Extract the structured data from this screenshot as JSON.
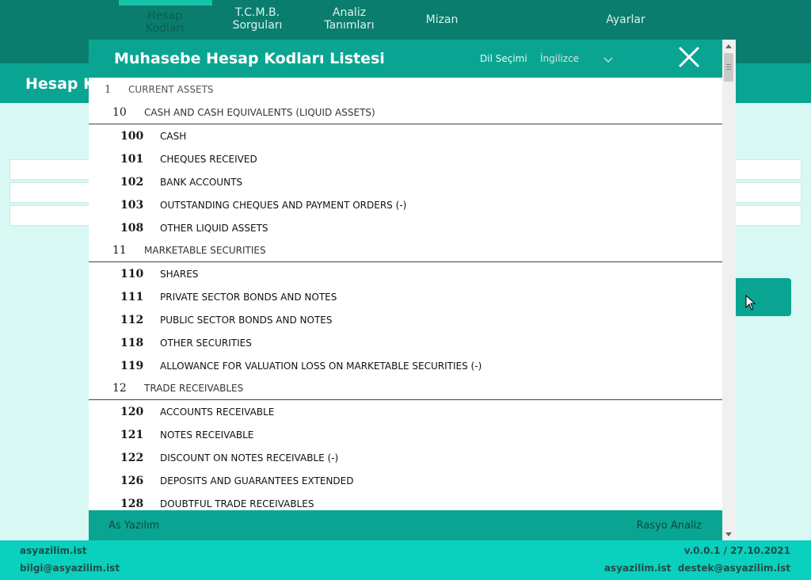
{
  "nav": {
    "items": [
      {
        "label1": "Hesap",
        "label2": "Kodları"
      },
      {
        "label1": "T.C.M.B.",
        "label2": "Sorguları"
      },
      {
        "label1": "Analiz",
        "label2": "Tanımları"
      },
      {
        "label1": "Mizan",
        "label2": ""
      },
      {
        "label1": "Ayarlar",
        "label2": ""
      }
    ]
  },
  "page": {
    "title_partial": "Hesap K"
  },
  "modal": {
    "title": "Muhasebe Hesap Kodları Listesi",
    "lang_label": "Dil Seçimi",
    "lang_value": "İngilizce",
    "footer_left": "As Yazılım",
    "footer_right": "Rasyo Analiz",
    "accounts": [
      {
        "code": "1",
        "name": "CURRENT ASSETS",
        "level": 1
      },
      {
        "code": "10",
        "name": "CASH AND CASH EQUIVALENTS (LIQUID ASSETS)",
        "level": 2
      },
      {
        "code": "100",
        "name": "CASH",
        "level": 3
      },
      {
        "code": "101",
        "name": "CHEQUES RECEIVED",
        "level": 3
      },
      {
        "code": "102",
        "name": "BANK ACCOUNTS",
        "level": 3
      },
      {
        "code": "103",
        "name": "OUTSTANDING CHEQUES AND PAYMENT ORDERS (-)",
        "level": 3
      },
      {
        "code": "108",
        "name": "OTHER LIQUID ASSETS",
        "level": 3
      },
      {
        "code": "11",
        "name": "MARKETABLE SECURITIES",
        "level": 2
      },
      {
        "code": "110",
        "name": "SHARES",
        "level": 3
      },
      {
        "code": "111",
        "name": "PRIVATE SECTOR BONDS AND NOTES",
        "level": 3
      },
      {
        "code": "112",
        "name": "PUBLIC SECTOR BONDS AND NOTES",
        "level": 3
      },
      {
        "code": "118",
        "name": "OTHER SECURITIES",
        "level": 3
      },
      {
        "code": "119",
        "name": "ALLOWANCE FOR VALUATION LOSS ON MARKETABLE SECURITIES (-)",
        "level": 3
      },
      {
        "code": "12",
        "name": "TRADE RECEIVABLES",
        "level": 2
      },
      {
        "code": "120",
        "name": "ACCOUNTS RECEIVABLE",
        "level": 3
      },
      {
        "code": "121",
        "name": "NOTES RECEIVABLE",
        "level": 3
      },
      {
        "code": "122",
        "name": "DISCOUNT ON NOTES RECEIVABLE (-)",
        "level": 3
      },
      {
        "code": "126",
        "name": "DEPOSITS AND GUARANTEES EXTENDED",
        "level": 3
      },
      {
        "code": "128",
        "name": "DOUBTFUL TRADE RECEIVABLES",
        "level": 3
      }
    ]
  },
  "footer": {
    "website": "asyazilim.ist",
    "email": "bilgi@asyazilim.ist",
    "version": "v.0.0.1 / 27.10.2021",
    "contact": "asyazilim.ist  destek@asyazilim.ist"
  },
  "icons": {
    "close": "close-icon",
    "dropdown": "chevron-down-icon",
    "cursor": "mouse-pointer-icon"
  },
  "colors": {
    "primary": "#0aa592",
    "nav": "#0b7d6e",
    "footer": "#0ad0be",
    "background": "#d8f8f4"
  }
}
